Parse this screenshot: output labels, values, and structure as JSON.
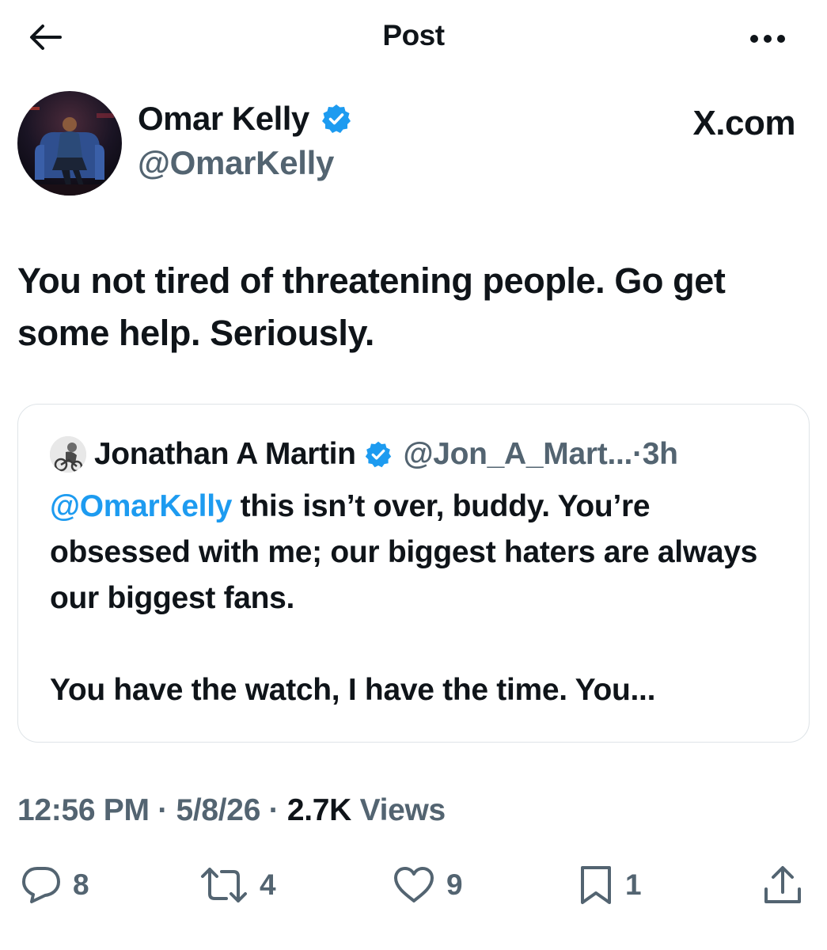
{
  "header": {
    "title": "Post",
    "back_icon": "arrow-left-icon",
    "more_icon": "more-horizontal-icon"
  },
  "author": {
    "name": "Omar Kelly",
    "handle": "@OmarKelly",
    "verified": true,
    "source": "X.com"
  },
  "post": {
    "text": "You not tired of threatening people. Go get some help. Seriously."
  },
  "quote": {
    "name": "Jonathan A Martin",
    "handle": "@Jon_A_Mart...",
    "dot": "·",
    "time": "3h",
    "verified": true,
    "mention": "@OmarKelly",
    "text_part1": " this isn’t over, buddy. You’re obsessed with me; our biggest haters are always our biggest fans.",
    "text_part2": "You have the watch, I have the time. You..."
  },
  "meta": {
    "time": "12:56 PM",
    "sep1": " · ",
    "date": "5/8/26",
    "sep2": " · ",
    "views_count": "2.7K",
    "views_label": " Views"
  },
  "actions": {
    "reply_count": "8",
    "repost_count": "4",
    "like_count": "9",
    "bookmark_count": "1"
  },
  "colors": {
    "accent": "#1d9bf0",
    "text": "#0f1419",
    "secondary": "#536471",
    "border": "#dfe4e8"
  }
}
